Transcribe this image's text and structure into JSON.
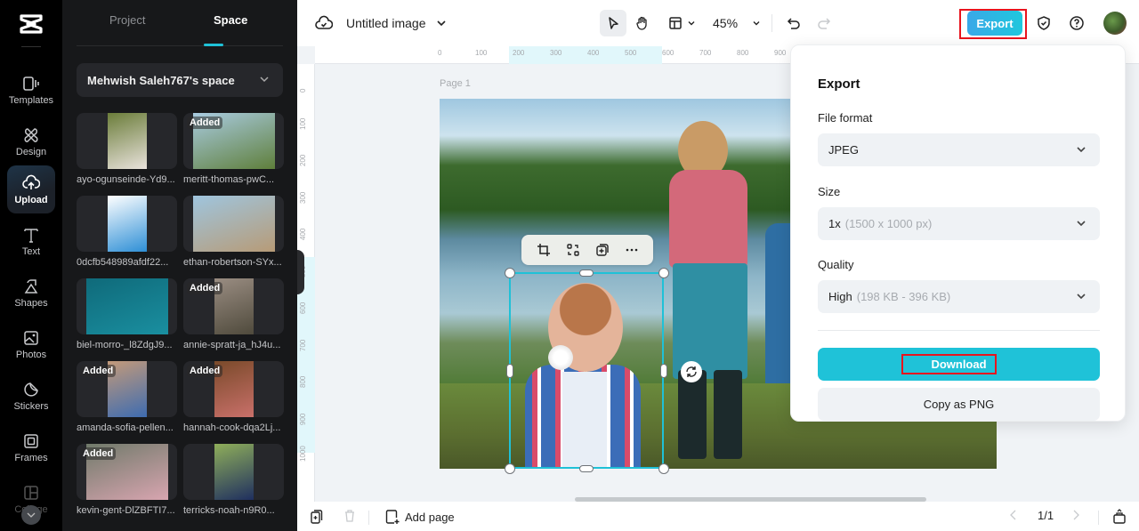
{
  "app": {
    "brand": "CapCut"
  },
  "rail": {
    "items": [
      {
        "label": "Templates",
        "icon": "templates-icon"
      },
      {
        "label": "Design",
        "icon": "design-icon"
      },
      {
        "label": "Upload",
        "icon": "upload-cloud-icon",
        "active": true
      },
      {
        "label": "Text",
        "icon": "text-icon"
      },
      {
        "label": "Shapes",
        "icon": "shapes-icon"
      },
      {
        "label": "Photos",
        "icon": "photos-icon"
      },
      {
        "label": "Stickers",
        "icon": "stickers-icon"
      },
      {
        "label": "Frames",
        "icon": "frames-icon"
      },
      {
        "label": "Collage",
        "icon": "collage-icon"
      }
    ]
  },
  "panel": {
    "tabs": [
      {
        "label": "Project"
      },
      {
        "label": "Space",
        "active": true
      }
    ],
    "space_selector": "Mehwish Saleh767's space",
    "assets": [
      {
        "name": "ayo-ogunseinde-Yd9...",
        "added": false,
        "colors": [
          "#6b7d3a",
          "#e9e2dc"
        ]
      },
      {
        "name": "meritt-thomas-pwC...",
        "added": true,
        "colors": [
          "#a9cbe0",
          "#5f7f3b"
        ]
      },
      {
        "name": "0dcfb548989afdf22...",
        "added": false,
        "colors": [
          "#ffffff",
          "#2e8fd6"
        ]
      },
      {
        "name": "ethan-robertson-SYx...",
        "added": false,
        "colors": [
          "#9fc5de",
          "#b79b77"
        ]
      },
      {
        "name": "biel-morro-_l8ZdgJ9...",
        "added": false,
        "colors": [
          "#0f6a7a",
          "#1a8fa0"
        ]
      },
      {
        "name": "annie-spratt-ja_hJ4u...",
        "added": true,
        "colors": [
          "#9a8d82",
          "#4f4a3c"
        ]
      },
      {
        "name": "amanda-sofia-pellen...",
        "added": true,
        "colors": [
          "#c39a7a",
          "#3e6cb0"
        ]
      },
      {
        "name": "hannah-cook-dqa2Lj...",
        "added": true,
        "colors": [
          "#7a4a2a",
          "#c9706a"
        ]
      },
      {
        "name": "kevin-gent-DlZBFTI7...",
        "added": true,
        "colors": [
          "#707a6a",
          "#d8a5b0"
        ]
      },
      {
        "name": "terricks-noah-n9R0...",
        "added": false,
        "colors": [
          "#8fae5a",
          "#1f2f5f"
        ]
      }
    ],
    "added_label": "Added"
  },
  "topbar": {
    "title": "Untitled image",
    "zoom": "45%",
    "export_label": "Export"
  },
  "canvas": {
    "page_label": "Page 1",
    "ruler_h": [
      "0",
      "100",
      "200",
      "300",
      "400",
      "500",
      "600",
      "700",
      "800",
      "900"
    ],
    "ruler_v": [
      "0",
      "100",
      "200",
      "300",
      "400",
      "500",
      "600",
      "700",
      "800",
      "900",
      "1000"
    ]
  },
  "export_panel": {
    "title": "Export",
    "file_format_label": "File format",
    "file_format_value": "JPEG",
    "size_label": "Size",
    "size_value": "1x",
    "size_detail": "(1500 x 1000 px)",
    "quality_label": "Quality",
    "quality_value": "High",
    "quality_detail": "(198 KB - 396 KB)",
    "download_label": "Download",
    "copy_label": "Copy as PNG"
  },
  "bottombar": {
    "add_page_label": "Add page",
    "page_indicator": "1/1"
  },
  "colors": {
    "accent": "#1fc2d8",
    "highlight_box": "#e8141e"
  }
}
